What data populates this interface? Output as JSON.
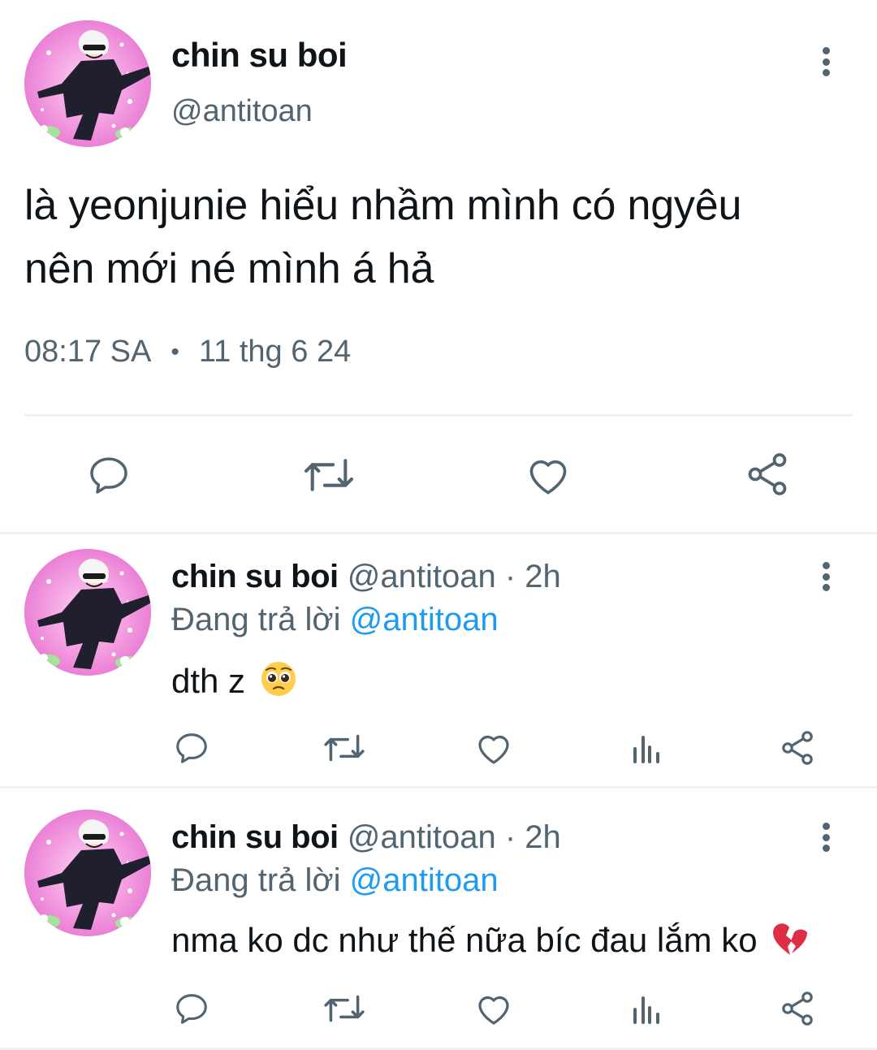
{
  "main_tweet": {
    "name": "chin su boi",
    "handle": "@antitoan",
    "text_line1": "là yeonjunie hiểu nhầm mình có ngyêu",
    "text_line2": "nên mới né mình á hả",
    "time": "08:17 SA",
    "separator": "•",
    "date": "11 thg 6 24",
    "actions": [
      "reply-icon",
      "retweet-icon",
      "like-icon",
      "share-icon"
    ]
  },
  "replies": [
    {
      "name": "chin su boi",
      "handle": "@antitoan",
      "separator": "·",
      "time": "2h",
      "replying_prefix": "Đang trả lời ",
      "replying_to": "@antitoan",
      "text": "dth z",
      "emoji": "pleading-face-emoji",
      "actions": [
        "reply-icon",
        "retweet-icon",
        "like-icon",
        "views-icon",
        "share-icon"
      ]
    },
    {
      "name": "chin su boi",
      "handle": "@antitoan",
      "separator": "·",
      "time": "2h",
      "replying_prefix": "Đang trả lời ",
      "replying_to": "@antitoan",
      "text": "nma ko dc như thế nữa bíc đau lắm ko",
      "emoji": "broken-heart-emoji",
      "actions": [
        "reply-icon",
        "retweet-icon",
        "like-icon",
        "views-icon",
        "share-icon"
      ]
    }
  ],
  "colors": {
    "text": "#0f1419",
    "secondary": "#536471",
    "mention": "#1d9bf0",
    "divider": "#eff3f4"
  }
}
